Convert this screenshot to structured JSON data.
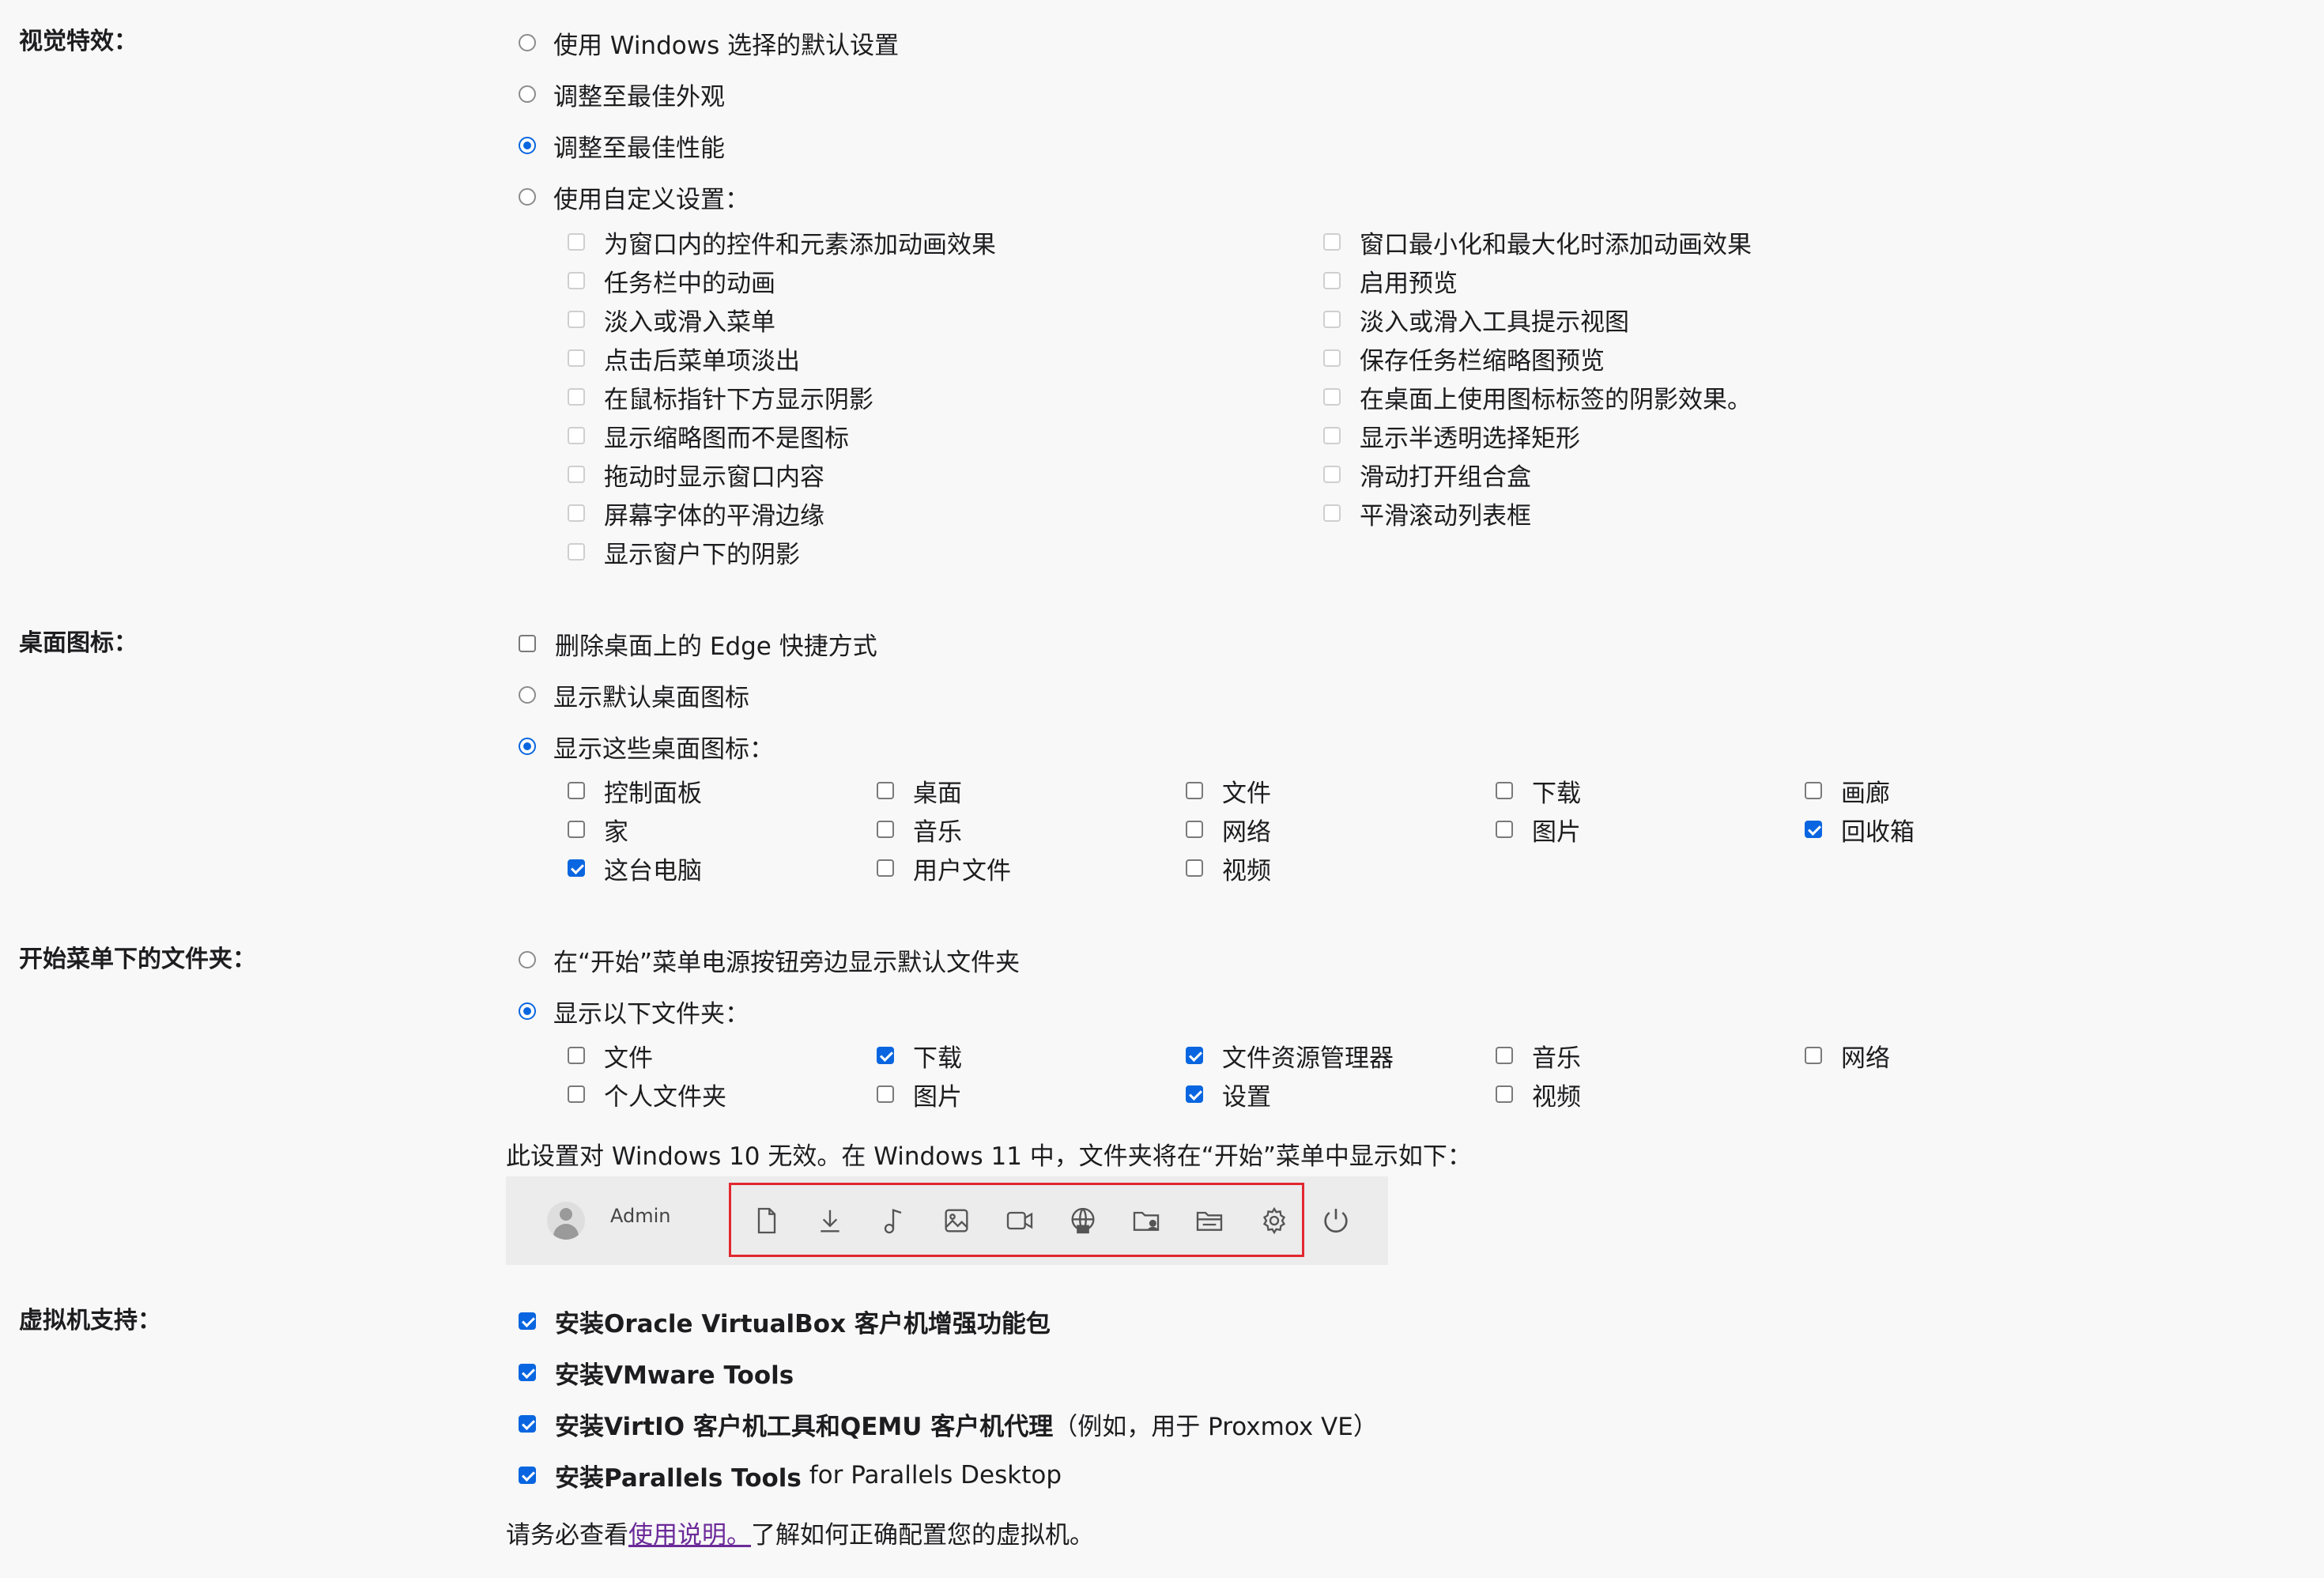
{
  "visual_effects": {
    "label": "视觉特效：",
    "options": [
      {
        "label": "使用 Windows 选择的默认设置",
        "selected": false
      },
      {
        "label": "调整至最佳外观",
        "selected": false
      },
      {
        "label": "调整至最佳性能",
        "selected": true
      },
      {
        "label": "使用自定义设置：",
        "selected": false
      }
    ],
    "custom_left": [
      "为窗口内的控件和元素添加动画效果",
      "任务栏中的动画",
      "淡入或滑入菜单",
      "点击后菜单项淡出",
      "在鼠标指针下方显示阴影",
      "显示缩略图而不是图标",
      "拖动时显示窗口内容",
      "屏幕字体的平滑边缘",
      "显示窗户下的阴影"
    ],
    "custom_right": [
      "窗口最小化和最大化时添加动画效果",
      "启用预览",
      "淡入或滑入工具提示视图",
      "保存任务栏缩略图预览",
      "在桌面上使用图标标签的阴影效果。",
      "显示半透明选择矩形",
      "滑动打开组合盒",
      "平滑滚动列表框"
    ]
  },
  "desktop_icons": {
    "label": "桌面图标：",
    "remove_edge": {
      "label": "删除桌面上的 Edge 快捷方式",
      "checked": false
    },
    "options": [
      {
        "label": "显示默认桌面图标",
        "selected": false
      },
      {
        "label": "显示这些桌面图标：",
        "selected": true
      }
    ],
    "icons": [
      {
        "label": "控制面板",
        "checked": false
      },
      {
        "label": "桌面",
        "checked": false
      },
      {
        "label": "文件",
        "checked": false
      },
      {
        "label": "下载",
        "checked": false
      },
      {
        "label": "画廊",
        "checked": false
      },
      {
        "label": "家",
        "checked": false
      },
      {
        "label": "音乐",
        "checked": false
      },
      {
        "label": "网络",
        "checked": false
      },
      {
        "label": "图片",
        "checked": false
      },
      {
        "label": "回收箱",
        "checked": true
      },
      {
        "label": "这台电脑",
        "checked": true
      },
      {
        "label": "用户文件",
        "checked": false
      },
      {
        "label": "视频",
        "checked": false
      }
    ]
  },
  "start_folders": {
    "label": "开始菜单下的文件夹：",
    "options": [
      {
        "label": "在“开始”菜单电源按钮旁边显示默认文件夹",
        "selected": false
      },
      {
        "label": "显示以下文件夹：",
        "selected": true
      }
    ],
    "folders": [
      {
        "label": "文件",
        "checked": false
      },
      {
        "label": "下载",
        "checked": true
      },
      {
        "label": "文件资源管理器",
        "checked": true
      },
      {
        "label": "音乐",
        "checked": false
      },
      {
        "label": "网络",
        "checked": false
      },
      {
        "label": "个人文件夹",
        "checked": false
      },
      {
        "label": "图片",
        "checked": false
      },
      {
        "label": "设置",
        "checked": true
      },
      {
        "label": "视频",
        "checked": false
      }
    ],
    "note": "此设置对 Windows 10 无效。在 Windows 11 中，文件夹将在“开始”菜单中显示如下：",
    "preview_user": "Admin",
    "preview_icons": [
      "document-icon",
      "download-icon",
      "music-icon",
      "pictures-icon",
      "video-icon",
      "network-icon",
      "personal-folder-icon",
      "file-explorer-icon",
      "settings-icon"
    ],
    "highlight_color": "#e2272f"
  },
  "vm_support": {
    "label": "虚拟机支持：",
    "items": [
      {
        "bold": "安装Oracle VirtualBox 客户机增强功能包",
        "rest": "",
        "checked": true
      },
      {
        "bold": "安装VMware Tools",
        "rest": "",
        "checked": true
      },
      {
        "bold": "安装VirtIO 客户机工具和QEMU 客户机代理",
        "rest": "（例如，用于 Proxmox VE）",
        "checked": true
      },
      {
        "bold": "安装Parallels Tools",
        "rest": " for Parallels Desktop",
        "checked": true
      }
    ],
    "footer_before": "请务必查看",
    "footer_link": "使用说明。",
    "footer_after": "了解如何正确配置您的虚拟机。"
  },
  "colors": {
    "accent": "#0a66e0",
    "link": "#6b2a99",
    "background": "#f8f8f8"
  }
}
